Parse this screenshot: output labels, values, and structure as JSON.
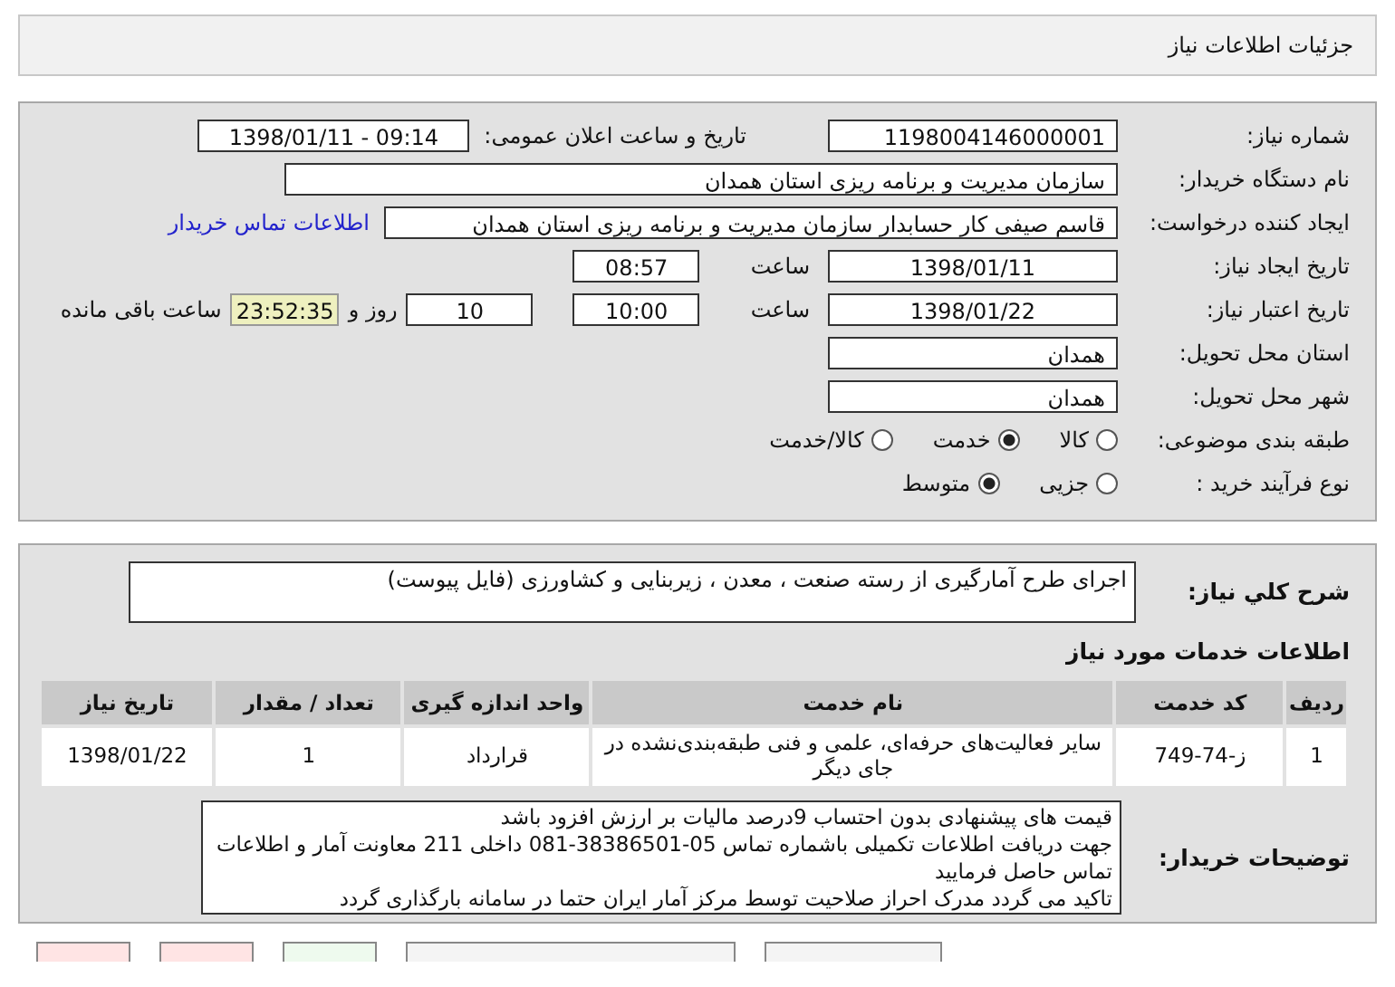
{
  "header": {
    "title": "جزئیات اطلاعات نیاز"
  },
  "details": {
    "need_number": {
      "label": "شماره نیاز:",
      "value": "1198004146000001"
    },
    "announce": {
      "label": "تاریخ و ساعت اعلان عمومی:",
      "value": "1398/01/11 - 09:14"
    },
    "buyer_org": {
      "label": "نام دستگاه خریدار:",
      "value": "سازمان مدیریت و برنامه ریزی استان همدان"
    },
    "requester": {
      "label": "ایجاد کننده درخواست:",
      "value": "قاسم صیفی کار حسابدار سازمان مدیریت و برنامه ریزی استان همدان",
      "link": "اطلاعات تماس خریدار"
    },
    "created": {
      "label": "تاریخ ایجاد نیاز:",
      "date": "1398/01/11",
      "time_label": "ساعت",
      "time": "08:57"
    },
    "valid": {
      "label": "تاریخ اعتبار نیاز:",
      "date": "1398/01/22",
      "time_label": "ساعت",
      "time": "10:00",
      "days": "10",
      "days_label": "روز و",
      "remaining": "23:52:35",
      "remaining_label": "ساعت باقی مانده"
    },
    "province": {
      "label": "استان محل تحویل:",
      "value": "همدان"
    },
    "city": {
      "label": "شهر محل تحویل:",
      "value": "همدان"
    },
    "category": {
      "label": "طبقه بندی موضوعی:",
      "options": [
        {
          "label": "کالا",
          "selected": false
        },
        {
          "label": "خدمت",
          "selected": true
        },
        {
          "label": "کالا/خدمت",
          "selected": false
        }
      ]
    },
    "process": {
      "label": "نوع فرآیند خرید :",
      "options": [
        {
          "label": "جزیی",
          "selected": false
        },
        {
          "label": "متوسط",
          "selected": true
        }
      ]
    }
  },
  "summary": {
    "label": "شرح کلي نیاز:",
    "value": "اجرای طرح آمارگیری از رسته صنعت ، معدن ، زیربنایی و کشاورزی (فایل پیوست)"
  },
  "services": {
    "title": "اطلاعات خدمات مورد نیاز",
    "columns": [
      "ردیف",
      "کد خدمت",
      "نام خدمت",
      "واحد اندازه گیری",
      "تعداد / مقدار",
      "تاریخ نیاز"
    ],
    "rows": [
      [
        "1",
        "ز-74-749",
        "سایر فعالیت‌های حرفه‌ای، علمی و فنی طبقه‌بندی‌نشده در جای دیگر",
        "قرارداد",
        "1",
        "1398/01/22"
      ]
    ]
  },
  "notes": {
    "label": "توضیحات خریدار:",
    "lines": [
      "قیمت های پیشنهادی بدون احتساب 9درصد مالیات بر ارزش افزود باشد",
      "جهت دریافت اطلاعات تکمیلی باشماره تماس 05-38386501-081 داخلی 211 معاونت آمار و اطلاعات تماس حاصل فرمایید",
      "تاکید می گردد مدرک احراز صلاحیت توسط مرکز آمار ایران حتما در سامانه بارگذاری گردد"
    ]
  },
  "bottom_buttons": [
    {
      "color": "#f4f4f4"
    },
    {
      "color": "#f4f4f4"
    },
    {
      "color": "#eefaee"
    },
    {
      "color": "#ffe4e4"
    },
    {
      "color": "#ffe4e4"
    }
  ]
}
